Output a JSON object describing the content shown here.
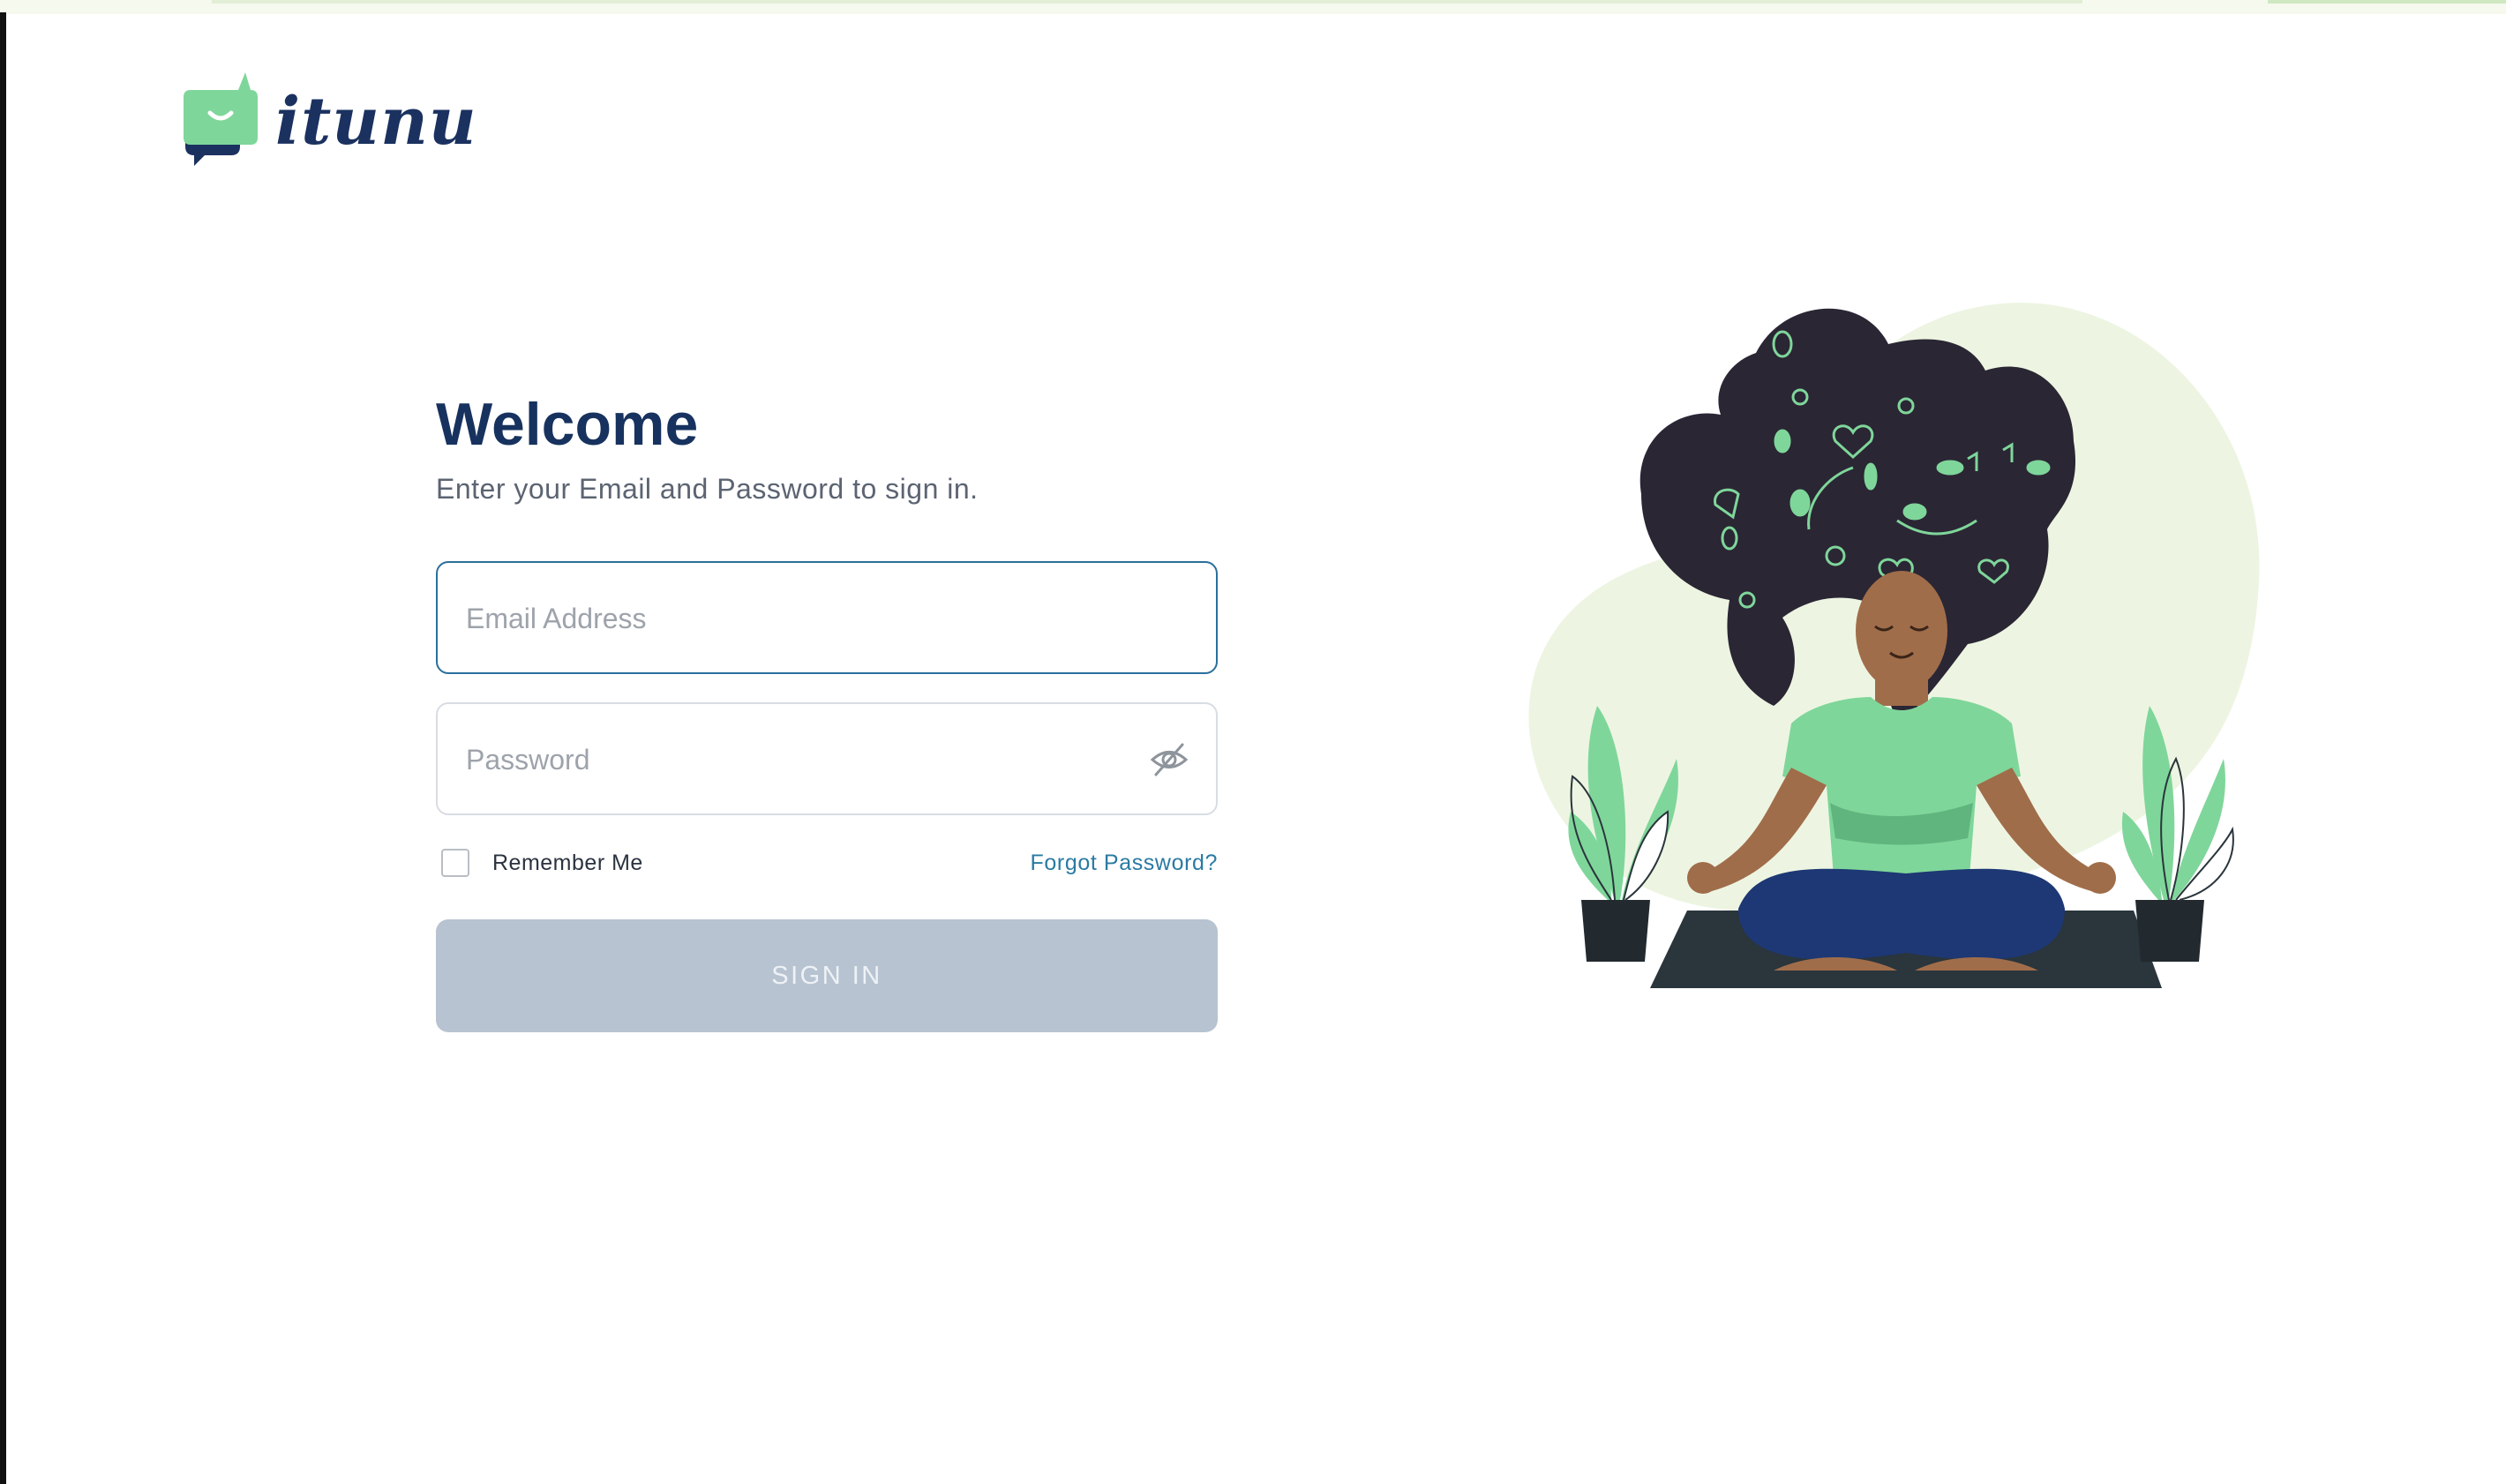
{
  "brand": {
    "name": "itunu",
    "primary_color": "#17325e",
    "accent_green": "#7fd69a",
    "link_color": "#2a7aa3"
  },
  "login": {
    "title": "Welcome",
    "subtitle": "Enter your Email and Password to sign in.",
    "email_placeholder": "Email Address",
    "email_value": "",
    "password_placeholder": "Password",
    "password_value": "",
    "password_toggle_icon": "eye-off-icon",
    "remember_label": "Remember Me",
    "remember_checked": false,
    "forgot_label": "Forgot Password?",
    "signin_label": "SIGN IN",
    "signin_disabled": true
  },
  "illustration": {
    "subject": "meditation-illustration"
  }
}
